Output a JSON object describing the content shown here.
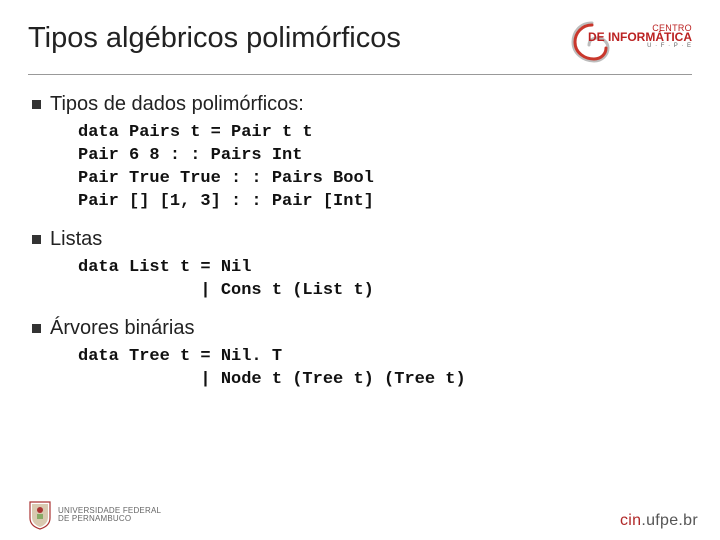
{
  "title": "Tipos algébricos polimórficos",
  "header_logo": {
    "line1": "CENTRO",
    "line2": "DE INFORMÁTICA",
    "line3": "U · F · P · E"
  },
  "sections": [
    {
      "heading": "Tipos de dados polimórficos:",
      "code": "data Pairs t = Pair t t\nPair 6 8 : : Pairs Int\nPair True True : : Pairs Bool\nPair [] [1, 3] : : Pair [Int]"
    },
    {
      "heading": "Listas",
      "code": "data List t = Nil\n            | Cons t (List t)"
    },
    {
      "heading": "Árvores binárias",
      "code": "data Tree t = Nil. T\n            | Node t (Tree t) (Tree t)"
    }
  ],
  "footer": {
    "ufpe_line1": "UNIVERSIDADE FEDERAL",
    "ufpe_line2": "DE PERNAMBUCO",
    "url_prefix": "cin",
    "url_suffix": ".ufpe.br"
  }
}
